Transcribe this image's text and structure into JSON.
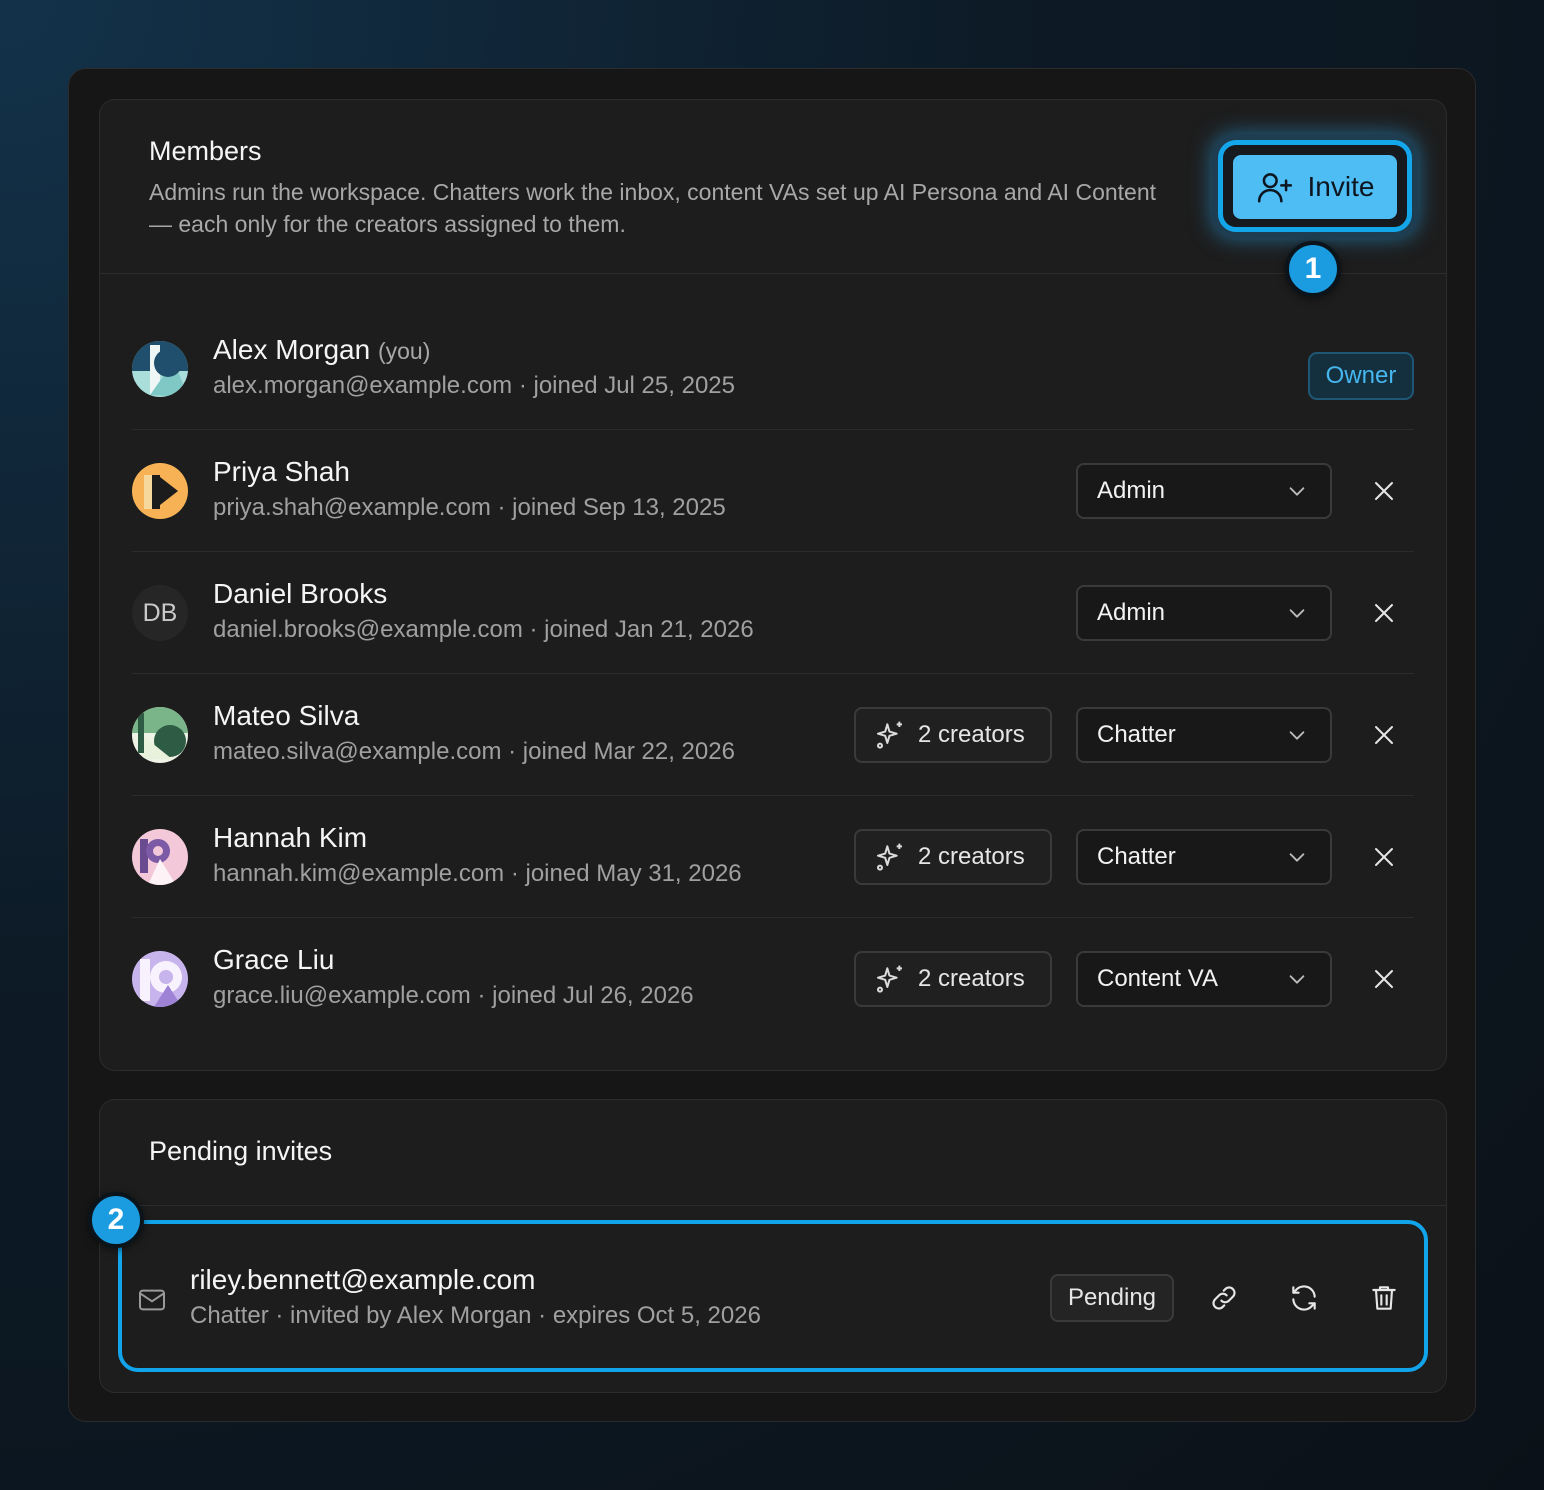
{
  "members": {
    "title": "Members",
    "description": "Admins run the workspace. Chatters work the inbox, content VAs set up AI Persona and AI Content — each only for the creators assigned to them.",
    "invite_label": "Invite",
    "invite_icon": "user-plus-icon",
    "owner_label": "Owner",
    "you_label": "(you)",
    "rows": [
      {
        "name": "Alex Morgan",
        "email": "alex.morgan@example.com",
        "joined": "· joined Jul 25, 2025",
        "role": "Owner"
      },
      {
        "name": "Priya Shah",
        "email": "priya.shah@example.com",
        "joined": "· joined Sep 13, 2025",
        "role": "Admin"
      },
      {
        "name": "Daniel Brooks",
        "initials": "DB",
        "email": "daniel.brooks@example.com",
        "joined": "· joined Jan 21, 2026",
        "role": "Admin"
      },
      {
        "name": "Mateo Silva",
        "email": "mateo.silva@example.com",
        "joined": "· joined Mar 22, 2026",
        "creators": "2 creators",
        "role": "Chatter"
      },
      {
        "name": "Hannah Kim",
        "email": "hannah.kim@example.com",
        "joined": "· joined May 31, 2026",
        "creators": "2 creators",
        "role": "Chatter"
      },
      {
        "name": "Grace Liu",
        "email": "grace.liu@example.com",
        "joined": "· joined Jul 26, 2026",
        "creators": "2 creators",
        "role": "Content VA"
      }
    ]
  },
  "pending": {
    "title": "Pending invites",
    "invites": [
      {
        "email": "riley.bennett@example.com",
        "details": "Chatter · invited by Alex Morgan · expires Oct 5, 2026",
        "status": "Pending"
      }
    ]
  },
  "annotations": {
    "first": "1",
    "second": "2"
  },
  "colors": {
    "accent": "#4dbdf4",
    "highlight": "#12a4ea",
    "owner_text": "#46b6ee"
  }
}
